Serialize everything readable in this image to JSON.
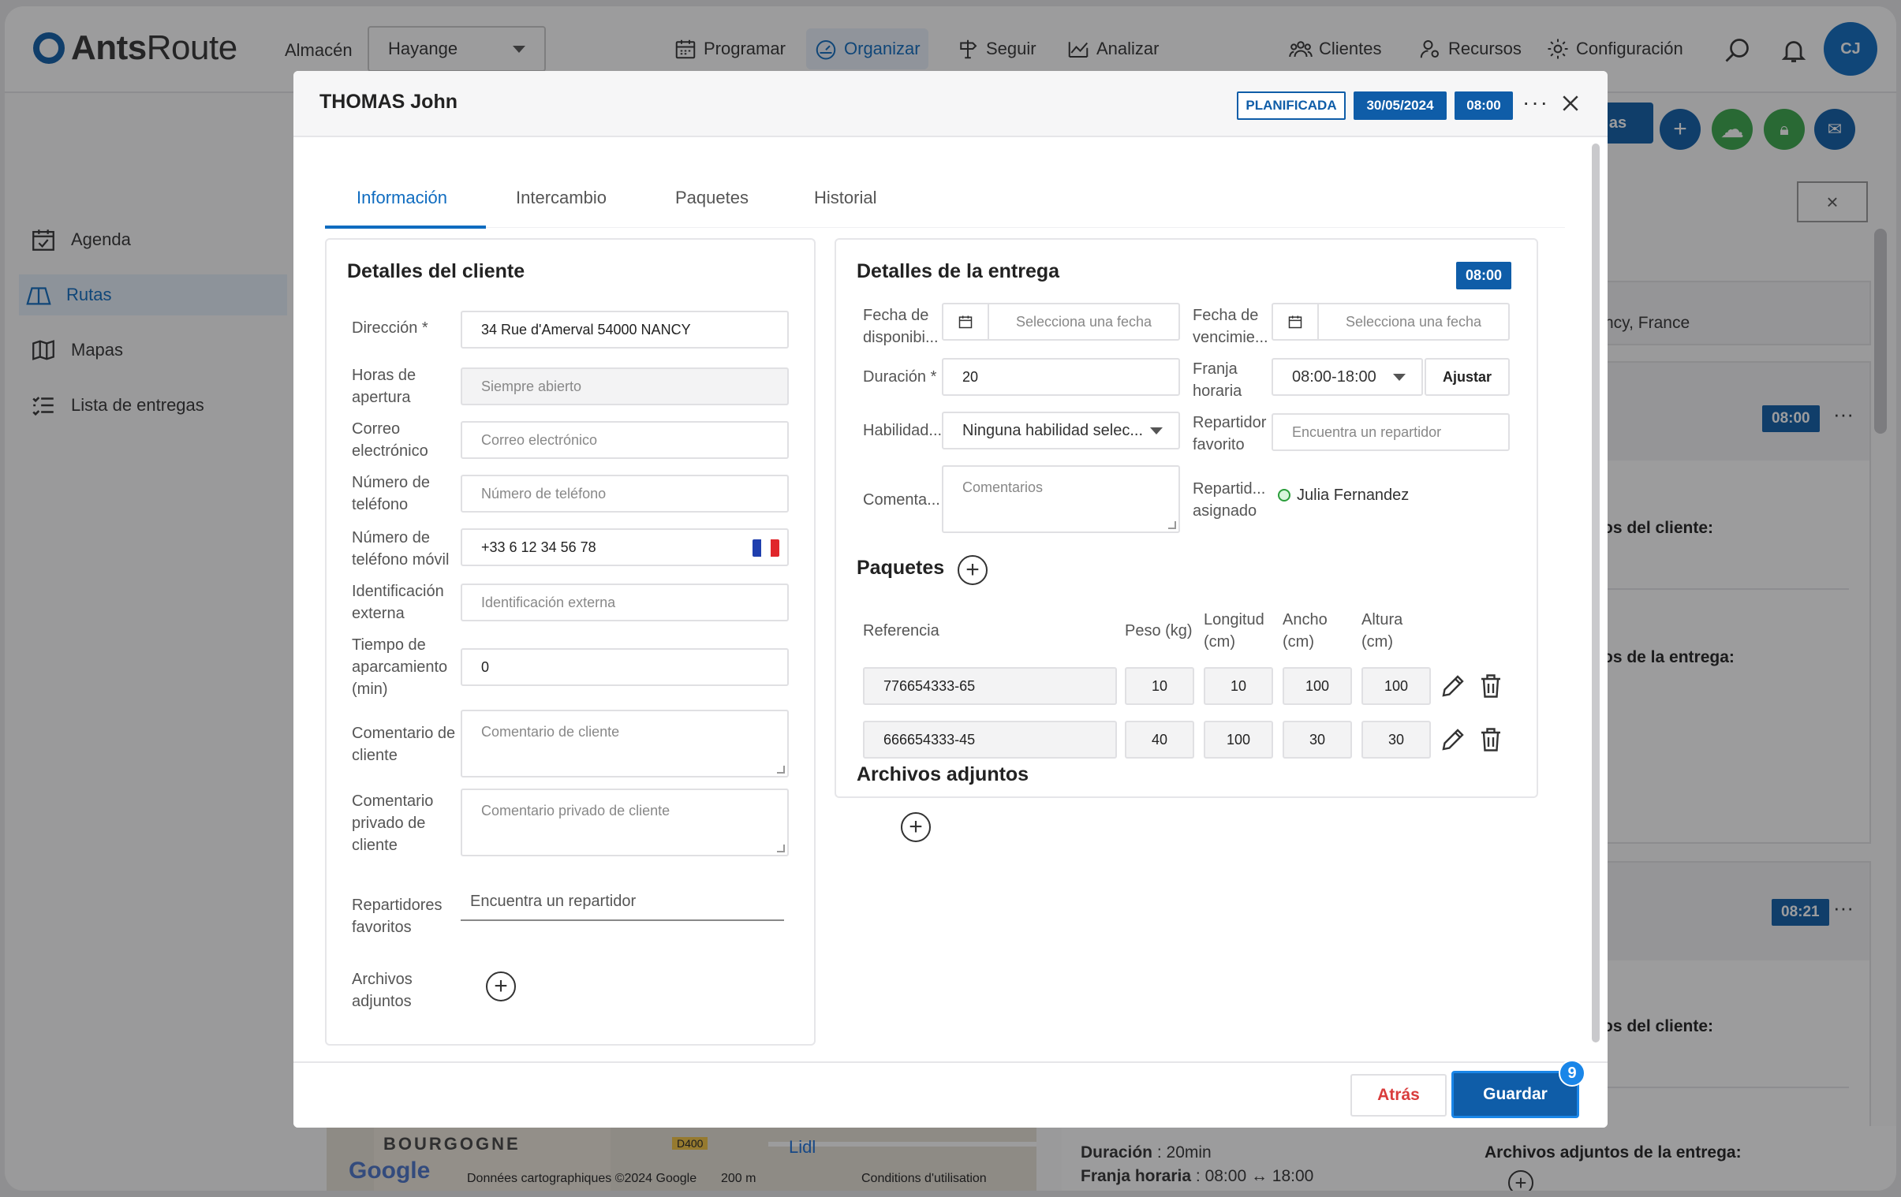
{
  "app": {
    "logo": {
      "bold": "Ants",
      "light": "Route"
    },
    "warehouse_label": "Almacén",
    "warehouse_value": "Hayange",
    "nav": {
      "programar": "Programar",
      "organizar": "Organizar",
      "seguir": "Seguir",
      "analizar": "Analizar",
      "clientes": "Clientes",
      "recursos": "Recursos",
      "configuracion": "Configuración"
    },
    "avatar_initials": "CJ",
    "accent_color": "#0f5da8"
  },
  "sidebar": {
    "items": [
      {
        "label": "Agenda",
        "icon": "calendar-check-icon"
      },
      {
        "label": "Rutas",
        "icon": "map-route-icon"
      },
      {
        "label": "Mapas",
        "icon": "map-pin-icon"
      },
      {
        "label": "Lista de entregas",
        "icon": "list-icon"
      }
    ]
  },
  "background": {
    "action_partial": "as",
    "address_partial": "ncy, France",
    "card1": {
      "time": "08:00",
      "client_label": "os del cliente:",
      "delivery_label": "os de la entrega:"
    },
    "card2": {
      "time": "08:21",
      "client_label": "os del cliente:"
    },
    "duration_label": "Duración",
    "duration_value": " : 20min",
    "window_label": "Franja horaria",
    "window_value": " : 08:00 ↔ 18:00",
    "attachments_label": "Archivos adjuntos de la entrega:",
    "map": {
      "region": "BOURGOGNE",
      "road": "D400",
      "store": "Lidl",
      "google": "Google",
      "credits": "Données cartographiques ©2024 Google",
      "scale": "200 m",
      "terms": "Conditions d'utilisation"
    }
  },
  "modal": {
    "title": "THOMAS John",
    "status": "PLANIFICADA",
    "date": "30/05/2024",
    "time": "08:00",
    "more": "···",
    "tabs": [
      "Información",
      "Intercambio",
      "Paquetes",
      "Historial"
    ],
    "client": {
      "title": "Detalles del cliente",
      "address_label": "Dirección *",
      "address_value": "34 Rue d'Amerval 54000 NANCY",
      "hours_label": "Horas de apertura",
      "hours_placeholder": "Siempre abierto",
      "email_label": "Correo electrónico",
      "email_placeholder": "Correo electrónico",
      "phone_label": "Número de teléfono",
      "phone_placeholder": "Número de teléfono",
      "mobile_label": "Número de teléfono móvil",
      "mobile_value": "+33 6 12 34 56 78",
      "external_id_label": "Identificación externa",
      "external_id_placeholder": "Identificación externa",
      "parking_label": "Tiempo de aparcamiento (min)",
      "parking_value": "0",
      "comment_label": "Comentario de cliente",
      "comment_placeholder": "Comentario de cliente",
      "private_comment_label": "Comentario privado de cliente",
      "private_comment_placeholder": "Comentario privado de cliente",
      "fav_drivers_label": "Repartidores favoritos",
      "fav_drivers_placeholder": "Encuentra un repartidor",
      "attachments_label": "Archivos adjuntos"
    },
    "delivery": {
      "title": "Detalles de la entrega",
      "time_badge": "08:00",
      "availability_label": "Fecha de disponibi...",
      "availability_placeholder": "Selecciona una fecha",
      "expiry_label": "Fecha de vencimie...",
      "expiry_placeholder": "Selecciona una fecha",
      "duration_label": "Duración *",
      "duration_value": "20",
      "window_label": "Franja horaria",
      "window_value": "08:00-18:00",
      "adjust_button": "Ajustar",
      "skills_label": "Habilidad...",
      "skills_value": "Ninguna habilidad selec...",
      "fav_driver_label": "Repartidor favorito",
      "fav_driver_placeholder": "Encuentra un repartidor",
      "comments_label": "Comenta...",
      "comments_placeholder": "Comentarios",
      "assigned_label": "Repartid... asignado",
      "assigned_value": "Julia Fernandez",
      "packages_title": "Paquetes",
      "columns": [
        "Referencia",
        "Peso (kg)",
        "Longitud (cm)",
        "Ancho (cm)",
        "Altura (cm)"
      ],
      "packages": [
        {
          "ref": "776654333-65",
          "weight": "10",
          "length": "10",
          "width": "100",
          "height": "100"
        },
        {
          "ref": "666654333-45",
          "weight": "40",
          "length": "100",
          "width": "30",
          "height": "30"
        }
      ],
      "attachments_title": "Archivos adjuntos"
    },
    "back_button": "Atrás",
    "save_button": "Guardar",
    "save_badge": "9"
  }
}
